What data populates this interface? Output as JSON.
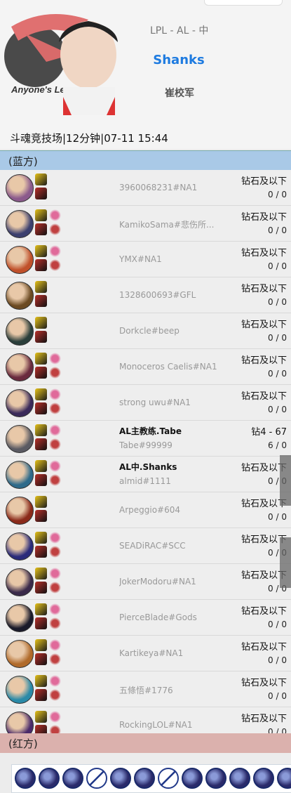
{
  "profile": {
    "league_info": "LPL - AL - 中",
    "display_name": "Shanks",
    "real_name": "崔校军",
    "logo_caption": "Anyone's Legend"
  },
  "match_info": "斗魂竞技场|12分钟|07-11 15:44",
  "teams": {
    "blue_label": "(蓝方)",
    "red_label": "(红方)"
  },
  "players": [
    {
      "name": "3960068231#NA1",
      "rank": "钻石及以下",
      "kda": "0 / 0",
      "champ_color": "#8b5a8c",
      "runes": false
    },
    {
      "name": "KamikoSama#悲伤所...",
      "rank": "钻石及以下",
      "kda": "0 / 0",
      "champ_color": "#3b3f6e",
      "runes": true
    },
    {
      "name": "YMX#NA1",
      "rank": "钻石及以下",
      "kda": "0 / 0",
      "champ_color": "#c0502a",
      "runes": true
    },
    {
      "name": "1328600693#GFL",
      "rank": "钻石及以下",
      "kda": "0 / 0",
      "champ_color": "#6b4a22",
      "runes": false
    },
    {
      "name": "Dorkcle#beep",
      "rank": "钻石及以下",
      "kda": "0 / 0",
      "champ_color": "#2a3e3a",
      "runes": false
    },
    {
      "name": "Monoceros Caelis#NA1",
      "rank": "钻石及以下",
      "kda": "0 / 0",
      "champ_color": "#6a2a3e",
      "runes": true
    },
    {
      "name": "strong uwu#NA1",
      "rank": "钻石及以下",
      "kda": "0 / 0",
      "champ_color": "#3a2a5a",
      "runes": true
    },
    {
      "name": "Tabe#99999",
      "proname": "AL主教练.Tabe",
      "rank": "钻4 - 67",
      "kda": "6 / 0",
      "champ_color": "#5a5a62",
      "runes": true
    },
    {
      "name": "almid#1111",
      "proname": "AL中.Shanks",
      "rank": "钻石及以下",
      "kda": "0 / 0",
      "champ_color": "#2e6a8a",
      "runes": true
    },
    {
      "name": "Arpeggio#604",
      "rank": "钻石及以下",
      "kda": "0 / 0",
      "champ_color": "#8a2a1a",
      "runes": false
    },
    {
      "name": "SEADiRAC#SCC",
      "rank": "钻石及以下",
      "kda": "0 / 0",
      "champ_color": "#2a2a7a",
      "runes": true
    },
    {
      "name": "JokerModoru#NA1",
      "rank": "钻石及以下",
      "kda": "0 / 0",
      "champ_color": "#3a2a4a",
      "runes": true
    },
    {
      "name": "PierceBlade#Gods",
      "rank": "钻石及以下",
      "kda": "0 / 0",
      "champ_color": "#1a1a2a",
      "runes": true
    },
    {
      "name": "Kartikeya#NA1",
      "rank": "钻石及以下",
      "kda": "0 / 0",
      "champ_color": "#b06a2a",
      "runes": true
    },
    {
      "name": "五條悟#1776",
      "rank": "钻石及以下",
      "kda": "0 / 0",
      "champ_color": "#2a8aa8",
      "runes": true
    },
    {
      "name": "RockingLOL#NA1",
      "rank": "钻石及以下",
      "kda": "0 / 0",
      "champ_color": "#4a2a6a",
      "runes": true
    }
  ],
  "bottom_icons": [
    "item",
    "item",
    "item",
    "empty",
    "item",
    "item",
    "empty",
    "item",
    "item",
    "item",
    "item",
    "item"
  ],
  "colors": {
    "accent": "#1e7be0",
    "blue_team": "#a9c9e7",
    "red_team": "#dbb1ad"
  }
}
